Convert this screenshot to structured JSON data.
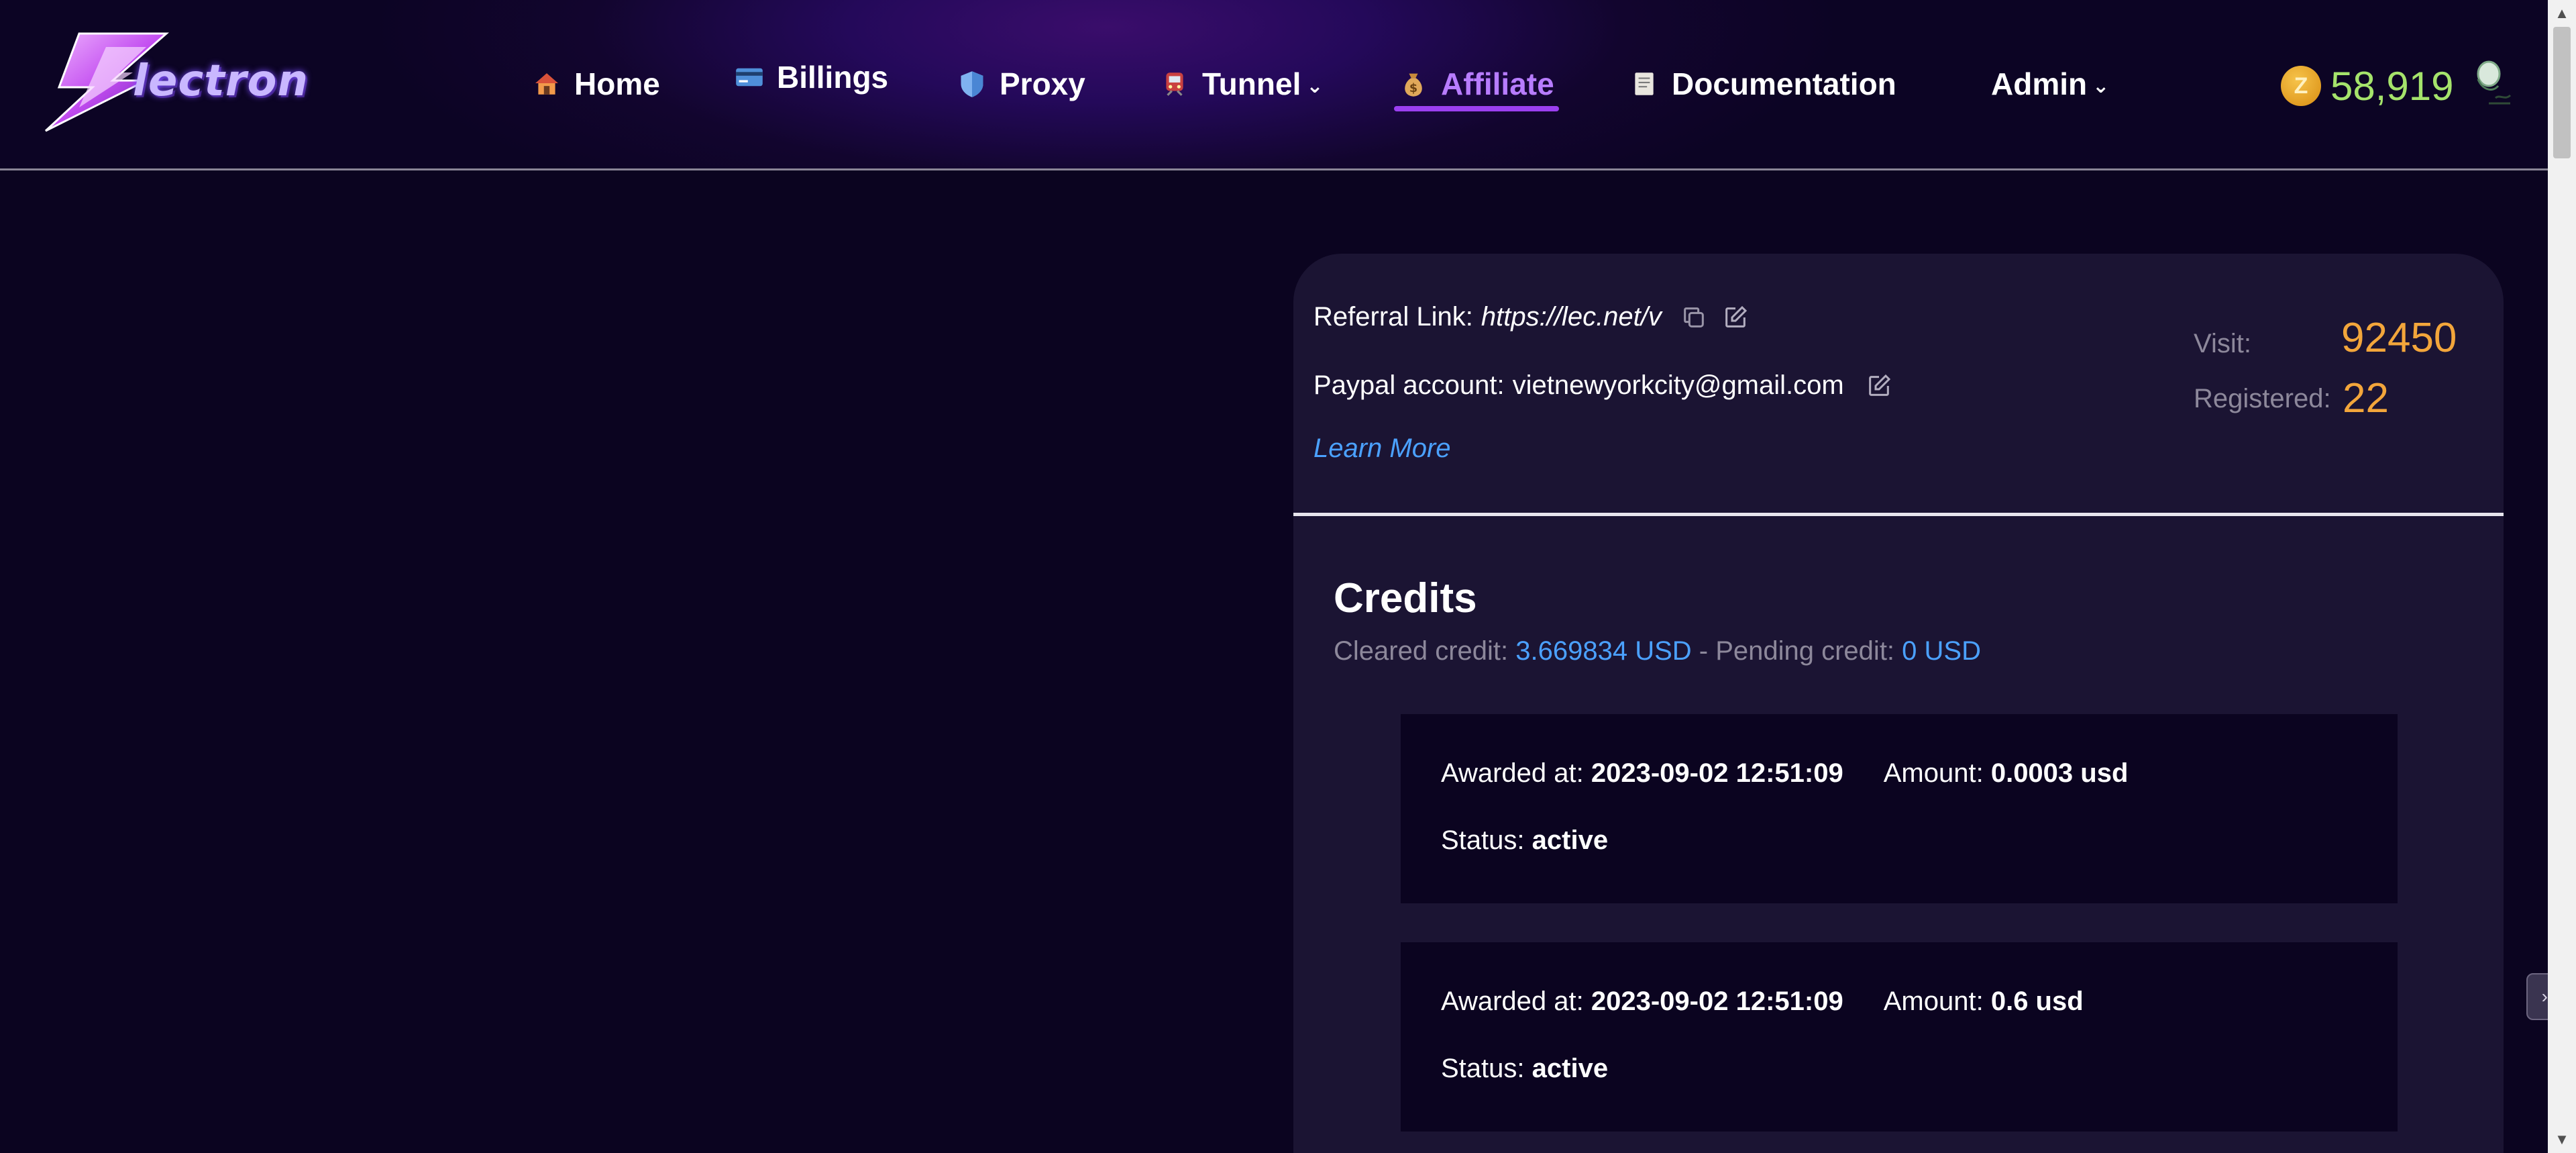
{
  "header": {
    "logo_text": "lectron",
    "nav": [
      {
        "label": "Home",
        "icon": "house-icon"
      },
      {
        "label": "Billings",
        "icon": "credit-card-icon"
      },
      {
        "label": "Proxy",
        "icon": "shield-icon"
      },
      {
        "label": "Tunnel",
        "icon": "train-icon"
      },
      {
        "label": "Affiliate",
        "icon": "money-bag-icon"
      },
      {
        "label": "Documentation",
        "icon": "document-icon"
      },
      {
        "label": "Admin",
        "icon": ""
      }
    ],
    "active_nav": "Affiliate",
    "coin_balance": "58,919",
    "coin_glyph": "Z"
  },
  "referral": {
    "link_label": "Referral Link:",
    "link_value": "https://lec.net/v",
    "paypal_label": "Paypal account:",
    "paypal_value": "vietnewyorkcity@gmail.com",
    "learn_more": "Learn More"
  },
  "stats": {
    "visit_label": "Visit:",
    "visit_value": "92450",
    "registered_label": "Registered:",
    "registered_value": "22"
  },
  "credits": {
    "title": "Credits",
    "cleared_label": "Cleared credit:",
    "cleared_value": "3.669834 USD",
    "separator": " - ",
    "pending_label": "Pending credit:",
    "pending_value": "0 USD",
    "entries": [
      {
        "awarded_label": "Awarded at:",
        "awarded_value": "2023-09-02 12:51:09",
        "amount_label": "Amount:",
        "amount_value": "0.0003 usd",
        "status_label": "Status:",
        "status_value": "active"
      },
      {
        "awarded_label": "Awarded at:",
        "awarded_value": "2023-09-02 12:51:09",
        "amount_label": "Amount:",
        "amount_value": "0.6 usd",
        "status_label": "Status:",
        "status_value": "active"
      }
    ]
  },
  "colors": {
    "background": "#0b0420",
    "card": "#1b1433",
    "accent_purple": "#b77cff",
    "link_blue": "#4ba1ff",
    "stat_orange": "#f3a63b",
    "coin_green": "#a5e36b"
  }
}
